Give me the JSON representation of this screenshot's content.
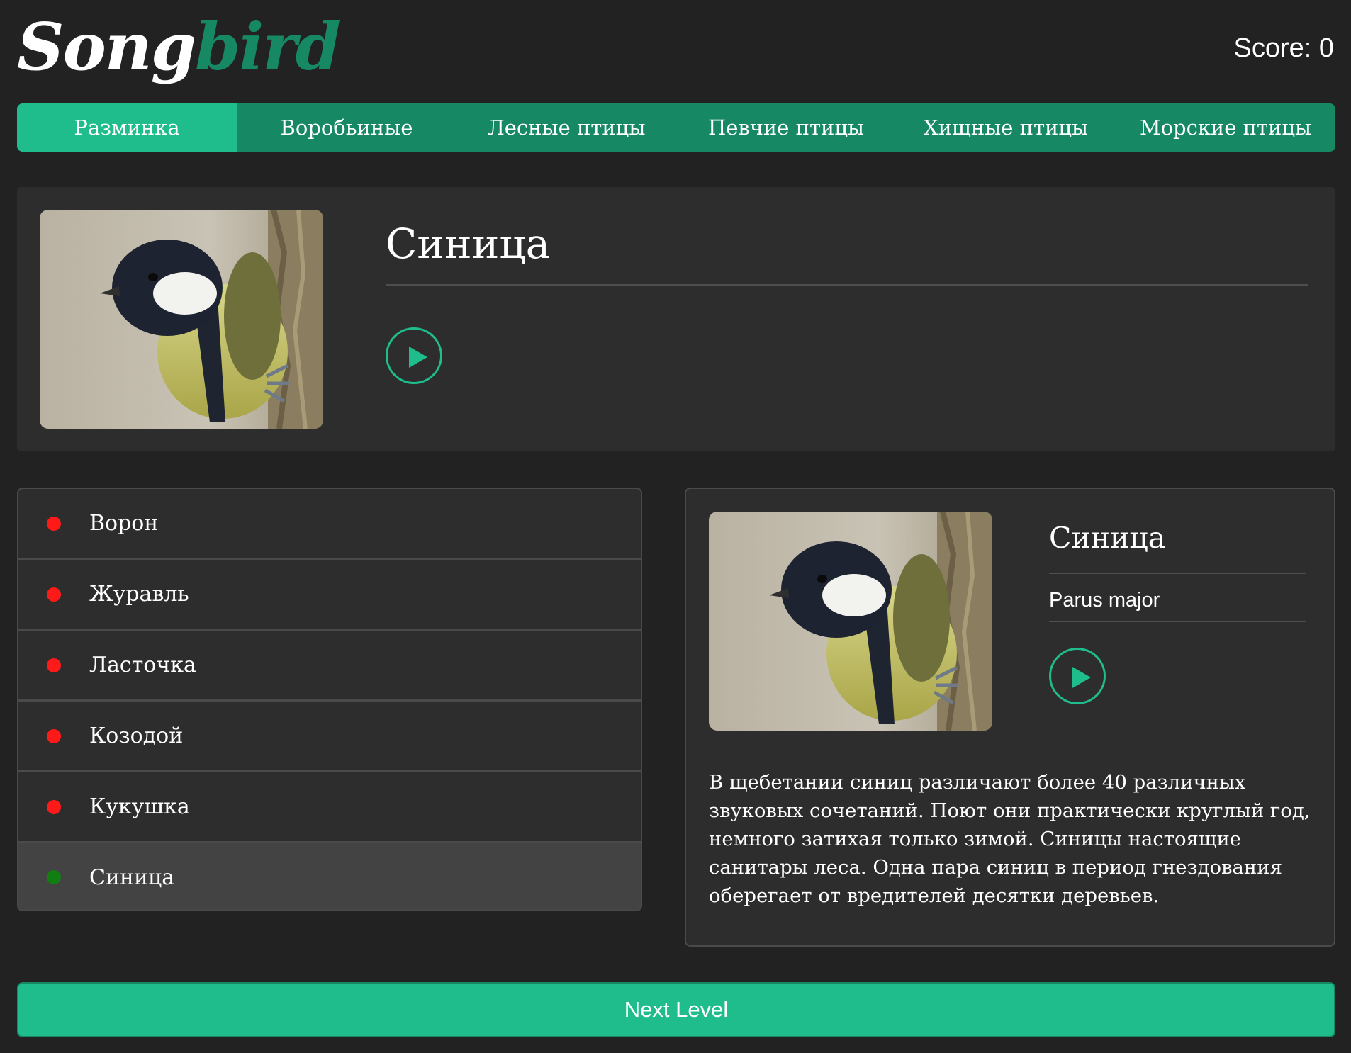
{
  "header": {
    "logo_part1": "Song",
    "logo_part2": "bird",
    "score": "Score: 0"
  },
  "nav": {
    "items": [
      "Разминка",
      "Воробьиные",
      "Лесные птицы",
      "Певчие птицы",
      "Хищные птицы",
      "Морские птицы"
    ],
    "active_index": 0
  },
  "question": {
    "bird_name": "Синица",
    "image": "great-tit-photo",
    "play_icon": "play-icon"
  },
  "answers": [
    {
      "label": "Ворон",
      "status": "wrong",
      "dot_color": "#ff1a1a"
    },
    {
      "label": "Журавль",
      "status": "wrong",
      "dot_color": "#ff1a1a"
    },
    {
      "label": "Ласточка",
      "status": "wrong",
      "dot_color": "#ff1a1a"
    },
    {
      "label": "Козодой",
      "status": "wrong",
      "dot_color": "#ff1a1a"
    },
    {
      "label": "Кукушка",
      "status": "wrong",
      "dot_color": "#ff1a1a"
    },
    {
      "label": "Синица",
      "status": "correct",
      "dot_color": "#117e11"
    }
  ],
  "details": {
    "name": "Синица",
    "latin_name": "Parus major",
    "description": "В щебетании синиц различают более 40 различных звуковых сочетаний. Поют они практически круглый год, немного затихая только зимой. Синицы настоящие санитары леса. Одна пара синиц в период гнездования оберегает от вредителей десятки деревьев."
  },
  "next_button": "Next Level",
  "colors": {
    "background": "#222222",
    "panel": "#2d2d2d",
    "accent": "#1fbd8c",
    "accent_dark": "#168964",
    "wrong": "#ff1a1a",
    "correct": "#117e11"
  }
}
